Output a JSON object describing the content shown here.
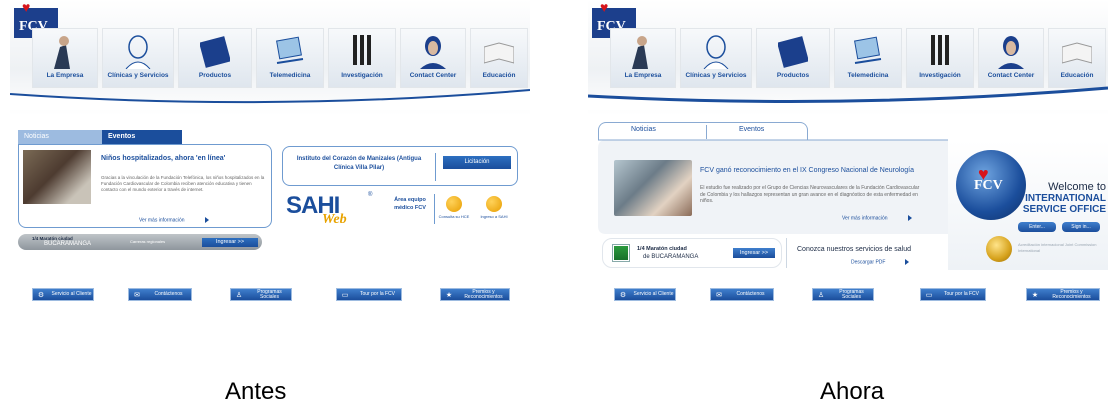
{
  "captions": {
    "before": "Antes",
    "after": "Ahora"
  },
  "logo_text": "FCV",
  "nav": {
    "items": [
      {
        "label": "La Empresa",
        "icon": "person-icon"
      },
      {
        "label": "Clínicas y Servicios",
        "icon": "doctor-icon"
      },
      {
        "label": "Productos",
        "icon": "book-icon"
      },
      {
        "label": "Telemedicina",
        "icon": "laptop-icon"
      },
      {
        "label": "Investigación",
        "icon": "test-tubes-icon"
      },
      {
        "label": "Contact Center",
        "icon": "headset-icon"
      },
      {
        "label": "Educación",
        "icon": "open-book-icon"
      }
    ]
  },
  "before": {
    "tabs": [
      "Noticias",
      "Eventos"
    ],
    "news": {
      "title": "Niños hospitalizados, ahora 'en línea'",
      "body": "Gracias a la vinculación de la Fundación Telefónica, los niños hospitalizados en la Fundación Cardiovascular de Colombia reciben atención educativa y tienen contacto con el mundo exterior a través de internet.",
      "more": "Ver más información"
    },
    "institute": {
      "name": "Instituto del Corazón de Manizales (Antigua Clínica Villa Pilar)",
      "button": "Licitación"
    },
    "sahi": {
      "brand": "SAHI",
      "web": "Web",
      "reg": "®"
    },
    "area_equipo": "Área equipo médico FCV",
    "consulta": "Consulta su HCE",
    "ingreso": "Ingreso a SAHI",
    "maraton": {
      "line1": "1/4 Maratón ciudad",
      "line2": "BUCARAMANGA",
      "note": "Carreras regionales",
      "button": "Ingresar >>"
    },
    "buttons": [
      {
        "label": "Servicio al Cliente",
        "icon": "gear-icon"
      },
      {
        "label": "Contáctenos",
        "icon": "mail-icon"
      },
      {
        "label": "Programas Sociales",
        "icon": "person-icon"
      },
      {
        "label": "Tour por la FCV",
        "icon": "folder-icon"
      },
      {
        "label": "Premios y Reconocimientos",
        "icon": "award-icon"
      }
    ]
  },
  "after": {
    "tabs": [
      "Noticias",
      "Eventos"
    ],
    "news": {
      "title": "FCV ganó reconocimiento en el IX Congreso Nacional de Neurología",
      "body": "El estudio fue realizado por el Grupo de Ciencias Neurovasculares de la Fundación Cardiovascular de Colombia y los hallazgos representan un gran avance en el diagnóstico de esta enfermedad en niños.",
      "more": "Ver más información"
    },
    "maraton": {
      "line1": "1/4 Maratón ciudad",
      "line2": "de BUCARAMANGA",
      "button": "Ingresar >>"
    },
    "servicios": {
      "text": "Conozca nuestros servicios de salud",
      "download": "Descargar PDF"
    },
    "international": {
      "welcome": "Welcome to",
      "name": "INTERNATIONAL SERVICE OFFICE",
      "enter": "Enter...",
      "sign_in": "Sign in..."
    },
    "seal_text": "Acreditación internacional Joint Commission International",
    "buttons": [
      {
        "label": "Servicio al Cliente",
        "icon": "gear-icon"
      },
      {
        "label": "Contáctenos",
        "icon": "mail-icon"
      },
      {
        "label": "Programas Sociales",
        "icon": "person-icon"
      },
      {
        "label": "Tour por la FCV",
        "icon": "folder-icon"
      },
      {
        "label": "Premios y Reconocimientos",
        "icon": "award-icon"
      }
    ]
  }
}
